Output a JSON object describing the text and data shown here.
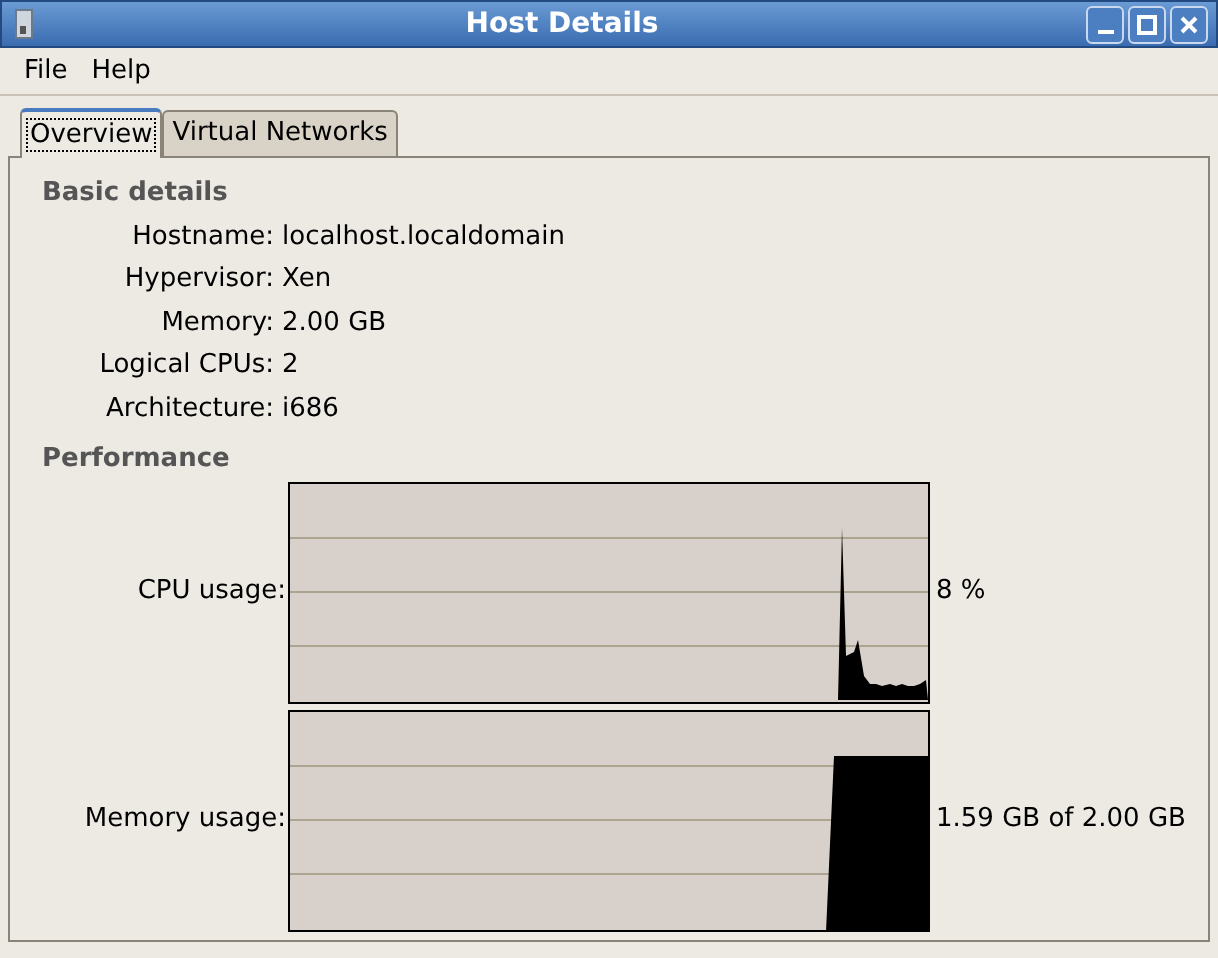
{
  "window": {
    "title": "Host Details"
  },
  "menu": [
    "File",
    "Help"
  ],
  "tabs": [
    {
      "label": "Overview",
      "selected": true
    },
    {
      "label": "Virtual Networks",
      "selected": false
    }
  ],
  "basic_details": {
    "heading": "Basic details",
    "rows": [
      {
        "label": "Hostname:",
        "value": "localhost.localdomain"
      },
      {
        "label": "Hypervisor:",
        "value": "Xen"
      },
      {
        "label": "Memory:",
        "value": "2.00 GB"
      },
      {
        "label": "Logical CPUs:",
        "value": "2"
      },
      {
        "label": "Architecture:",
        "value": "i686"
      }
    ]
  },
  "performance": {
    "heading": "Performance",
    "rows": [
      {
        "kind": "cpu",
        "label": "CPU usage:",
        "reading": "8 %"
      },
      {
        "kind": "memory",
        "label": "Memory usage:",
        "reading": "1.59 GB of 2.00 GB"
      }
    ]
  }
}
